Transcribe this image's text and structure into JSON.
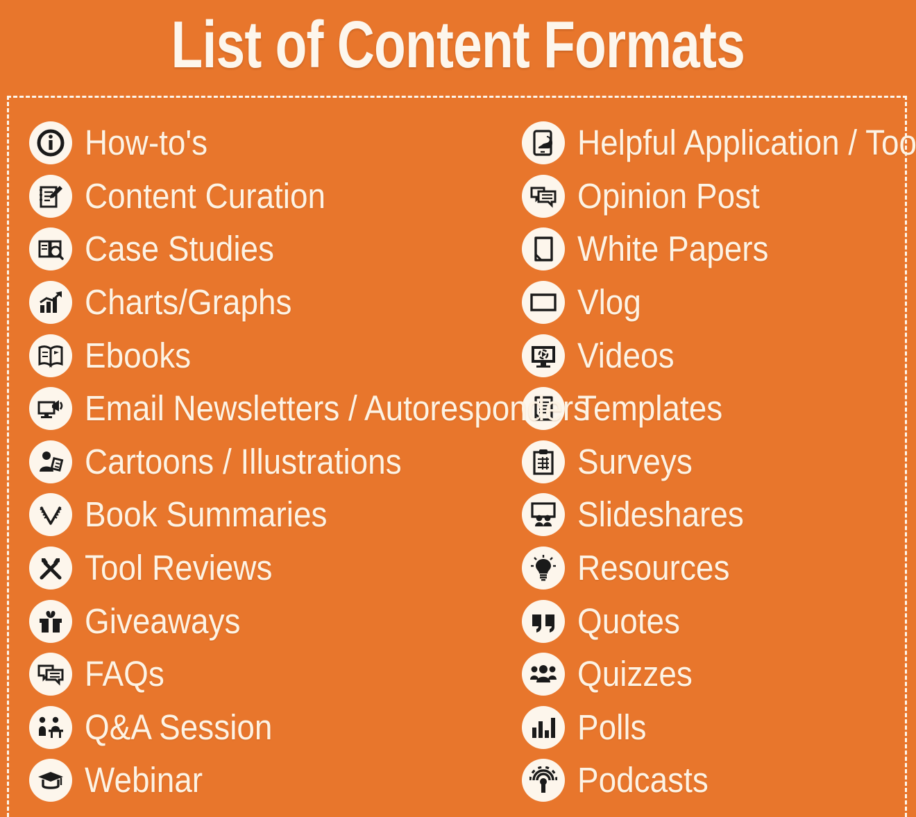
{
  "header": {
    "title": "List of Content Formats"
  },
  "colors": {
    "background_orange": "#e8762c",
    "text_cream": "#fdf3e4",
    "icon_badge": "#fdf6ec",
    "icon_glyph": "#1a1a1a",
    "dashed_border": "#fdf6ec"
  },
  "columns": {
    "left": [
      {
        "label": "How-to's",
        "icon": "info-circle-icon"
      },
      {
        "label": "Content Curation",
        "icon": "notepad-pencil-icon"
      },
      {
        "label": "Case Studies",
        "icon": "book-magnifier-icon"
      },
      {
        "label": "Charts/Graphs",
        "icon": "bar-chart-arrow-icon"
      },
      {
        "label": "Ebooks",
        "icon": "open-book-icon"
      },
      {
        "label": "Email Newsletters / Autoresponders",
        "icon": "monitor-megaphone-icon"
      },
      {
        "label": "Cartoons / Illustrations",
        "icon": "person-drawing-icon"
      },
      {
        "label": "Book Summaries",
        "icon": "laurel-wreath-icon"
      },
      {
        "label": "Tool Reviews",
        "icon": "wrench-screwdriver-icon"
      },
      {
        "label": "Giveaways",
        "icon": "gift-box-icon"
      },
      {
        "label": "FAQs",
        "icon": "speech-bubbles-icon"
      },
      {
        "label": "Q&A Session",
        "icon": "interview-desk-icon"
      },
      {
        "label": "Webinar",
        "icon": "graduation-cap-icon"
      }
    ],
    "right": [
      {
        "label": "Helpful Application / Tool",
        "icon": "smartphone-app-icon"
      },
      {
        "label": "Opinion Post",
        "icon": "chat-bubbles-icon"
      },
      {
        "label": "White Papers",
        "icon": "document-folded-icon"
      },
      {
        "label": "Vlog",
        "icon": "screen-rectangle-icon"
      },
      {
        "label": "Videos",
        "icon": "monitor-play-icon"
      },
      {
        "label": "Templates",
        "icon": "document-lines-icon"
      },
      {
        "label": "Surveys",
        "icon": "clipboard-grid-icon"
      },
      {
        "label": "Slideshares",
        "icon": "presentation-people-icon"
      },
      {
        "label": "Resources",
        "icon": "lightbulb-icon"
      },
      {
        "label": "Quotes",
        "icon": "quotation-marks-icon"
      },
      {
        "label": "Quizzes",
        "icon": "people-group-icon"
      },
      {
        "label": "Polls",
        "icon": "bar-chart-icon"
      },
      {
        "label": "Podcasts",
        "icon": "podcast-broadcast-icon"
      }
    ]
  }
}
